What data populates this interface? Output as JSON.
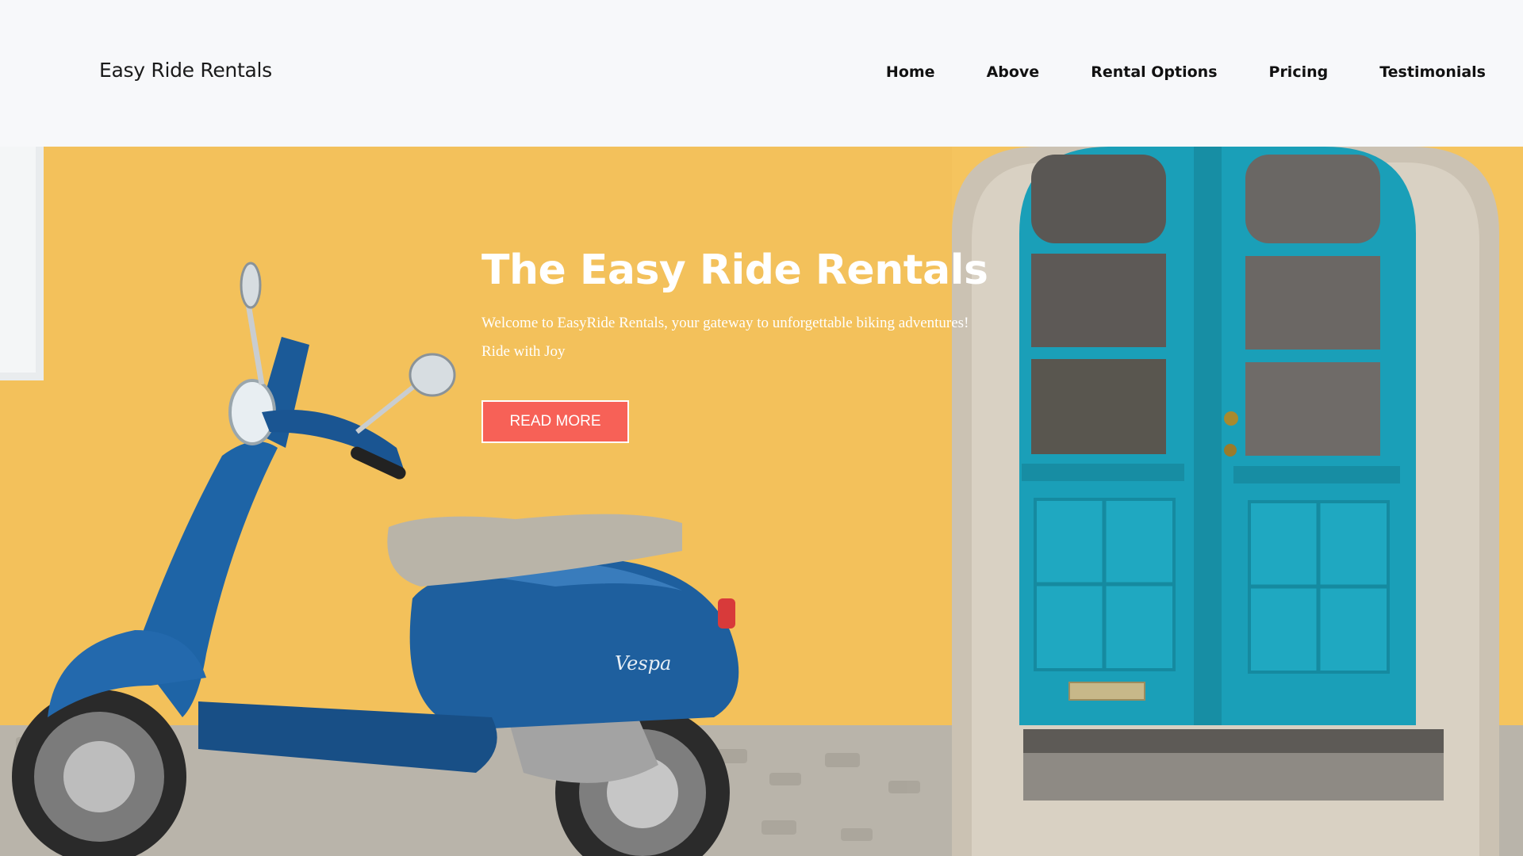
{
  "header": {
    "brand": "Easy Ride Rentals",
    "nav": [
      {
        "label": "Home"
      },
      {
        "label": "Above"
      },
      {
        "label": "Rental Options"
      },
      {
        "label": "Pricing"
      },
      {
        "label": "Testimonials"
      }
    ]
  },
  "hero": {
    "title": "The Easy Ride Rentals",
    "subtitle_line1": "Welcome to EasyRide Rentals, your gateway to unforgettable biking adventures!",
    "subtitle_line2": "Ride with Joy",
    "cta_label": "READ MORE",
    "image_subject": "blue scooter parked in front of yellow wall with teal double door"
  },
  "colors": {
    "cta_background": "#f76157",
    "wall": "#f5c45e",
    "door": "#1a9fb8",
    "scooter": "#1e5f9e",
    "nav_background": "#f7f8fa"
  }
}
